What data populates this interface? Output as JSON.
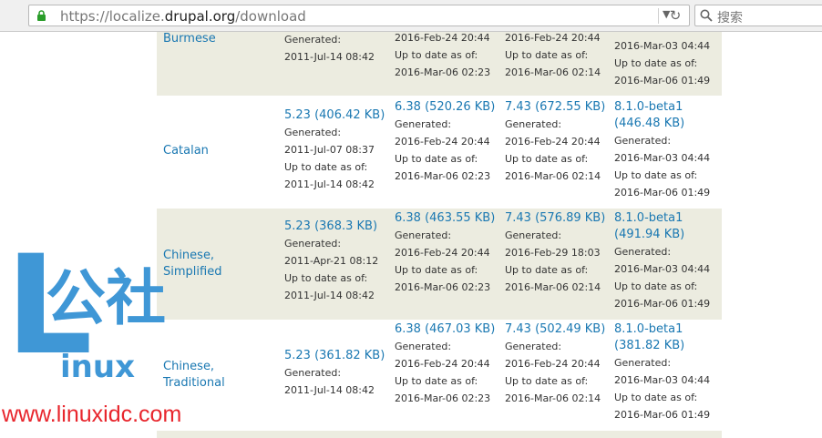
{
  "browser": {
    "url_prefix": "https://localize.",
    "url_host": "drupal.org",
    "url_path": "/download",
    "search_placeholder": "搜索"
  },
  "labels": {
    "generated": "Generated:",
    "uptodate": "Up to date as of:"
  },
  "rows": [
    {
      "language": "Burmese",
      "cells": [
        {
          "version": "",
          "generated": "2011-Jul-14 08:42",
          "uptodate": ""
        },
        {
          "version": "",
          "generated": "",
          "uptodate": "2016-Mar-06 02:23",
          "top_line": "2016-Feb-24 20:44"
        },
        {
          "version": "",
          "generated": "",
          "uptodate": "2016-Mar-06 02:14",
          "top_line": "2016-Feb-24 20:44"
        },
        {
          "version": "",
          "generated": "2016-Mar-03 04:44",
          "uptodate": "2016-Mar-06 01:49"
        }
      ]
    },
    {
      "language": "Catalan",
      "cells": [
        {
          "version": "5.23 (406.42 KB)",
          "generated": "2011-Jul-07 08:37",
          "uptodate": "2011-Jul-14 08:42"
        },
        {
          "version": "6.38 (520.26 KB)",
          "generated": "2016-Feb-24 20:44",
          "uptodate": "2016-Mar-06 02:23"
        },
        {
          "version": "7.43 (672.55 KB)",
          "generated": "2016-Feb-24 20:44",
          "uptodate": "2016-Mar-06 02:14"
        },
        {
          "version": "8.1.0-beta1 (446.48 KB)",
          "generated": "2016-Mar-03 04:44",
          "uptodate": "2016-Mar-06 01:49"
        }
      ]
    },
    {
      "language": "Chinese, Simplified",
      "cells": [
        {
          "version": "5.23 (368.3 KB)",
          "generated": "2011-Apr-21 08:12",
          "uptodate": "2011-Jul-14 08:42"
        },
        {
          "version": "6.38 (463.55 KB)",
          "generated": "2016-Feb-24 20:44",
          "uptodate": "2016-Mar-06 02:23"
        },
        {
          "version": "7.43 (576.89 KB)",
          "generated": "2016-Feb-29 18:03",
          "uptodate": "2016-Mar-06 02:14"
        },
        {
          "version": "8.1.0-beta1 (491.94 KB)",
          "generated": "2016-Mar-03 04:44",
          "uptodate": "2016-Mar-06 01:49"
        }
      ]
    },
    {
      "language": "Chinese, Traditional",
      "cells": [
        {
          "version": "5.23 (361.82 KB)",
          "generated": "2011-Jul-14 08:42",
          "uptodate": ""
        },
        {
          "version": "6.38 (467.03 KB)",
          "generated": "2016-Feb-24 20:44",
          "uptodate": "2016-Mar-06 02:23"
        },
        {
          "version": "7.43 (502.49 KB)",
          "generated": "2016-Feb-24 20:44",
          "uptodate": "2016-Mar-06 02:14"
        },
        {
          "version": "8.1.0-beta1 (381.82 KB)",
          "generated": "2016-Mar-03 04:44",
          "uptodate": "2016-Mar-06 01:49"
        }
      ]
    }
  ],
  "watermark": {
    "title": "公社",
    "letter": "L",
    "word": "inux",
    "url": "www.linuxidc.com"
  },
  "colors": {
    "link": "#1a78b2",
    "shade": "#ecece0",
    "watermark_blue": "#3f97d6",
    "watermark_red": "#e8262d"
  }
}
